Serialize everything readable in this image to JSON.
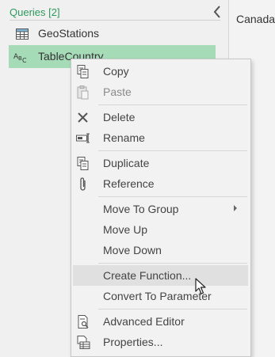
{
  "queries_pane": {
    "header": "Queries [2]",
    "items": [
      {
        "label": "GeoStations",
        "icon": "table-icon",
        "selected": false
      },
      {
        "label": "TableCountry",
        "icon": "text-type-icon",
        "icon_text": "ABC",
        "selected": true
      }
    ]
  },
  "right_pane": {
    "text": "Canada"
  },
  "context_menu": {
    "items": [
      {
        "label": "Copy",
        "icon": "copy-icon"
      },
      {
        "label": "Paste",
        "icon": "paste-icon",
        "disabled": true
      },
      {
        "label": "Delete",
        "icon": "delete-icon"
      },
      {
        "label": "Rename",
        "icon": "rename-icon"
      },
      {
        "label": "Duplicate",
        "icon": "duplicate-icon"
      },
      {
        "label": "Reference",
        "icon": "reference-icon"
      },
      {
        "label": "Move To Group",
        "has_submenu": true
      },
      {
        "label": "Move Up"
      },
      {
        "label": "Move Down"
      },
      {
        "label": "Create Function...",
        "hovered": true
      },
      {
        "label": "Convert To Parameter"
      },
      {
        "label": "Advanced Editor",
        "icon": "advanced-editor-icon"
      },
      {
        "label": "Properties...",
        "icon": "properties-icon"
      }
    ]
  },
  "colors": {
    "accent_green": "#2d9a5c",
    "selected_bg": "#a6dbb7",
    "menu_bg": "#f2f2f2",
    "hover_bg": "#e0e0e0"
  }
}
